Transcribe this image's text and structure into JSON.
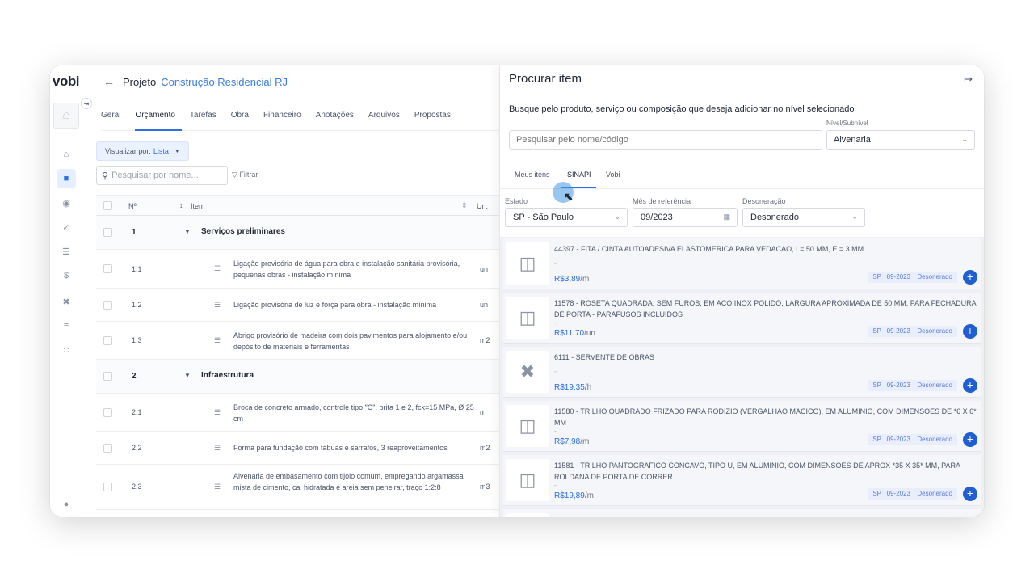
{
  "app": {
    "logo": "vobi",
    "back_arrow": "←",
    "project_label": "Projeto",
    "project_name": "Construção Residencial RJ"
  },
  "tabs": [
    "Geral",
    "Orçamento",
    "Tarefas",
    "Obra",
    "Financeiro",
    "Anotações",
    "Arquivos",
    "Propostas"
  ],
  "toolbar": {
    "view_label": "Visualizar por:",
    "view_value": "Lista",
    "search_placeholder": "Pesquisar por nome...",
    "filter_label": "Filtrar"
  },
  "table": {
    "headers": {
      "number": "Nº",
      "item": "Item",
      "unit": "Un."
    },
    "groups": [
      {
        "number": "1",
        "title": "Serviços preliminares",
        "rows": [
          {
            "number": "1.1",
            "item": "Ligação provisória de água para obra e instalação sanitária provisória, pequenas obras - instalação mínima",
            "unit": "un"
          },
          {
            "number": "1.2",
            "item": "Ligação provisória de luz e força para obra - instalação mínima",
            "unit": "un"
          },
          {
            "number": "1.3",
            "item": "Abrigo provisório de madeira com dois pavimentos para alojamento e/ou depósito de materiais e ferramentas",
            "unit": "m2"
          }
        ]
      },
      {
        "number": "2",
        "title": "Infraestrutura",
        "rows": [
          {
            "number": "2.1",
            "item": "Broca de concreto armado, controle tipo \"C\", brita 1 e 2, fck=15 MPa, Ø 25 cm",
            "unit": "m"
          },
          {
            "number": "2.2",
            "item": "Forma para fundação com tábuas e sarrafos, 3 reaproveitamentos",
            "unit": "m2"
          },
          {
            "number": "2.3",
            "item": "Alvenaria de embasamento com tijolo comum, empregando argamassa mista de cimento, cal hidratada e areia sem peneirar, traço 1:2:8",
            "unit": "m3"
          }
        ]
      }
    ]
  },
  "drawer": {
    "title": "Procurar item",
    "description": "Busque pelo produto, serviço ou composição que deseja adicionar no nível selecionado",
    "search_placeholder": "Pesquisar pelo nome/código",
    "level_label": "Nível/Subnível",
    "level_value": "Alvenaria",
    "tabs": [
      "Meus itens",
      "SINAPI",
      "Vobi"
    ],
    "filters": {
      "state_label": "Estado",
      "state_value": "SP - São Paulo",
      "month_label": "Mês de referência",
      "month_value": "09/2023",
      "tax_label": "Desoneração",
      "tax_value": "Desonerado"
    },
    "results": [
      {
        "title": "44397 - FITA / CINTA AUTOADESIVA ELASTOMERICA PARA VEDACAO, L= 50 MM, E = 3 MM",
        "price": "R$3,89",
        "unit": "/m",
        "icon": "box-icon",
        "chips": [
          "SP",
          "09-2023",
          "Desonerado"
        ]
      },
      {
        "title": "11578 - ROSETA QUADRADA, SEM FUROS, EM ACO INOX POLIDO, LARGURA APROXIMADA DE 50 MM, PARA FECHADURA DE PORTA - PARAFUSOS INCLUIDOS",
        "price": "R$11,70",
        "unit": "/un",
        "icon": "box-icon",
        "chips": [
          "SP",
          "09-2023",
          "Desonerado"
        ]
      },
      {
        "title": "6111 - SERVENTE DE OBRAS",
        "price": "R$19,35",
        "unit": "/h",
        "icon": "tools-icon",
        "chips": [
          "SP",
          "09-2023",
          "Desonerado"
        ]
      },
      {
        "title": "11580 - TRILHO QUADRADO FRIZADO PARA RODIZIO (VERGALHAO MACICO), EM ALUMINIO, COM DIMENSOES DE *6 X 6* MM",
        "price": "R$7,98",
        "unit": "/m",
        "icon": "box-icon",
        "chips": [
          "SP",
          "09-2023",
          "Desonerado"
        ]
      },
      {
        "title": "11581 - TRILHO PANTOGRAFICO CONCAVO, TIPO U, EM ALUMINIO, COM DIMENSOES DE APROX *35 X 35* MM, PARA ROLDANA DE PORTA DE CORRER",
        "price": "R$19,89",
        "unit": "/m",
        "icon": "box-icon",
        "chips": [
          "SP",
          "09-2023",
          "Desonerado"
        ]
      }
    ],
    "dash": "-"
  },
  "colors": {
    "accent": "#2b6fe0",
    "add_button": "#1f5fd1",
    "chip_bg": "#e8eefc"
  }
}
